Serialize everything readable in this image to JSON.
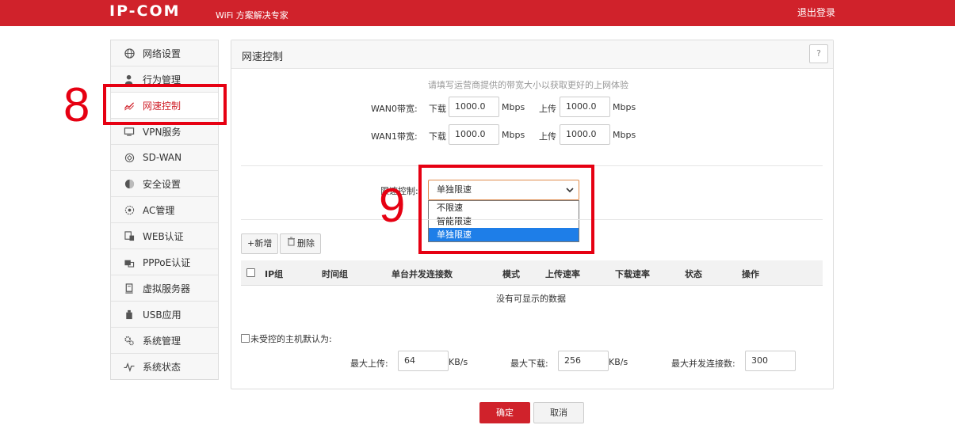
{
  "header": {
    "logo": "IP-COM",
    "slogan": "WiFi 方案解决专家",
    "logout": "退出登录"
  },
  "sidebar": {
    "items": [
      {
        "label": "网络设置",
        "icon": "globe-icon"
      },
      {
        "label": "行为管理",
        "icon": "user-manage-icon"
      },
      {
        "label": "网速控制",
        "icon": "speed-chart-icon",
        "active": true
      },
      {
        "label": "VPN服务",
        "icon": "monitor-icon"
      },
      {
        "label": "SD-WAN",
        "icon": "sdwan-icon"
      },
      {
        "label": "安全设置",
        "icon": "shield-icon"
      },
      {
        "label": "AC管理",
        "icon": "ac-icon"
      },
      {
        "label": "WEB认证",
        "icon": "web-auth-icon"
      },
      {
        "label": "PPPoE认证",
        "icon": "pppoe-icon"
      },
      {
        "label": "虚拟服务器",
        "icon": "server-icon"
      },
      {
        "label": "USB应用",
        "icon": "usb-icon"
      },
      {
        "label": "系统管理",
        "icon": "gears-icon"
      },
      {
        "label": "系统状态",
        "icon": "pulse-icon"
      }
    ]
  },
  "annotations": {
    "step8": "8",
    "step9": "9"
  },
  "panel": {
    "title": "网速控制",
    "help": "?",
    "hint": "请填写运营商提供的带宽大小以获取更好的上网体验",
    "wan": [
      {
        "label": "WAN0带宽:",
        "down_label": "下载",
        "down": "1000.0",
        "unit1": "Mbps",
        "up_label": "上传",
        "up": "1000.0",
        "unit2": "Mbps"
      },
      {
        "label": "WAN1带宽:",
        "down_label": "下载",
        "down": "1000.0",
        "unit1": "Mbps",
        "up_label": "上传",
        "up": "1000.0",
        "unit2": "Mbps"
      }
    ],
    "speed_control": {
      "label": "限速控制:",
      "selected": "单独限速",
      "options": [
        "不限速",
        "智能限速",
        "单独限速"
      ]
    },
    "toolbar": {
      "add": "+新增",
      "delete": "删除"
    },
    "table": {
      "columns": [
        "IP组",
        "时间组",
        "单台并发连接数",
        "模式",
        "上传速率",
        "下载速率",
        "状态",
        "操作"
      ],
      "empty": "没有可显示的数据"
    },
    "default_host": {
      "label": "未受控的主机默认为:",
      "max_up_label": "最大上传:",
      "max_up": "64",
      "max_up_unit": "KB/s",
      "max_down_label": "最大下载:",
      "max_down": "256",
      "max_down_unit": "KB/s",
      "max_conn_label": "最大并发连接数:",
      "max_conn": "300"
    }
  },
  "footer": {
    "ok": "确定",
    "cancel": "取消"
  },
  "colors": {
    "brand": "#d0222b",
    "annotation": "#e60012",
    "selected": "#1e7ee8"
  }
}
